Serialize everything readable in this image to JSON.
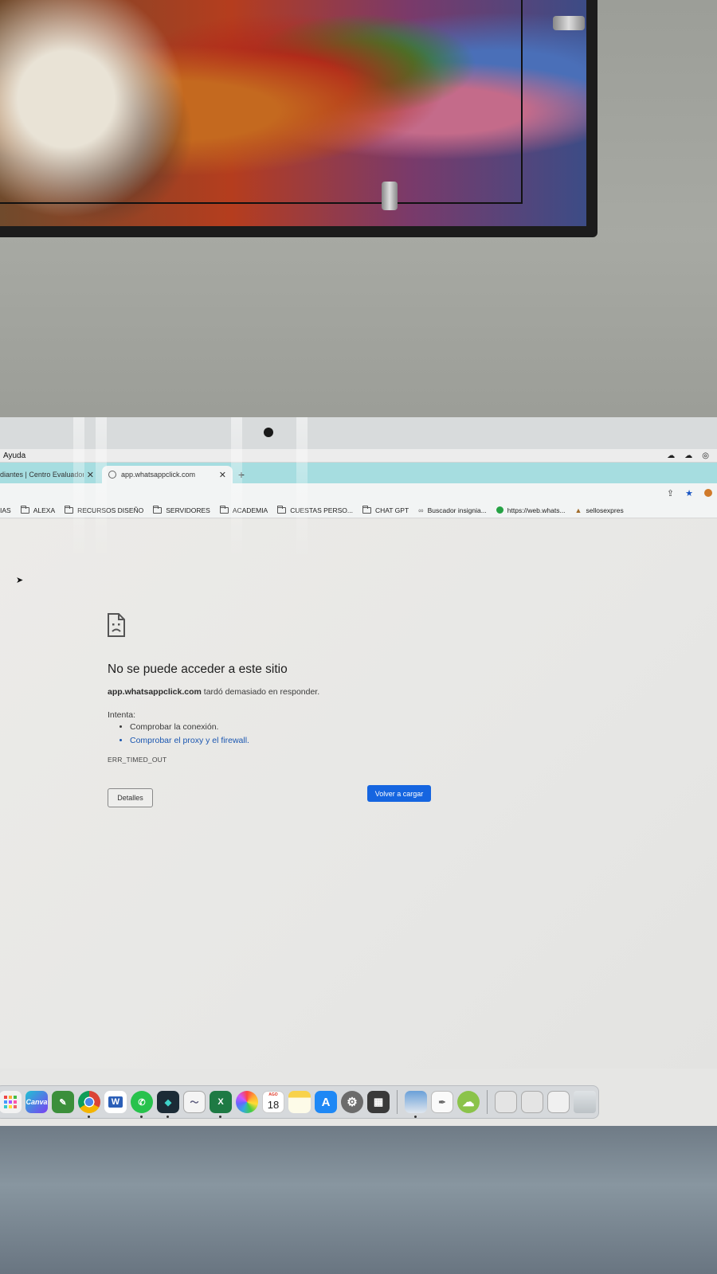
{
  "menubar": {
    "menu_item": "Ayuda"
  },
  "tabs": [
    {
      "title": "diantes | Centro Evaluador",
      "active": false
    },
    {
      "title": "app.whatsappclick.com",
      "active": true
    }
  ],
  "bookmarks": [
    {
      "label": "IAS",
      "kind": "text"
    },
    {
      "label": "ALEXA",
      "kind": "folder"
    },
    {
      "label": "RECURSOS DISEÑO",
      "kind": "folder"
    },
    {
      "label": "SERVIDORES",
      "kind": "folder"
    },
    {
      "label": "ACADEMIA",
      "kind": "folder"
    },
    {
      "label": "CUESTAS PERSO...",
      "kind": "folder"
    },
    {
      "label": "CHAT GPT",
      "kind": "folder"
    },
    {
      "label": "Buscador insignia...",
      "kind": "link"
    },
    {
      "label": "https://web.whats...",
      "kind": "whatsapp"
    },
    {
      "label": "sellosexpres",
      "kind": "stamp"
    }
  ],
  "error": {
    "title": "No se puede acceder a este sitio",
    "host": "app.whatsappclick.com",
    "desc_suffix": " tardó demasiado en responder.",
    "try_label": "Intenta:",
    "suggestions": [
      "Comprobar la conexión.",
      "Comprobar el proxy y el firewall."
    ],
    "code": "ERR_TIMED_OUT",
    "details_button": "Detalles",
    "reload_button": "Volver a cargar"
  },
  "dock": {
    "icons": [
      "launchpad-icon",
      "canva-icon",
      "pencil-app-icon",
      "chrome-icon",
      "word-icon",
      "whatsapp-icon",
      "filmora-icon",
      "preview-icon",
      "excel-icon",
      "photos-icon",
      "calendar-icon",
      "notes-icon",
      "app-store-icon",
      "system-settings-icon",
      "calculator-icon",
      "image-capture-icon",
      "textedit-icon",
      "cloud-upload-icon",
      "document-stack-icon",
      "document-stack-2-icon",
      "document-stack-3-icon",
      "trash-icon"
    ],
    "canva_label": "Canva",
    "calendar_month": "AGO",
    "calendar_day": "18",
    "word_letter": "W",
    "excel_letter": "X"
  }
}
